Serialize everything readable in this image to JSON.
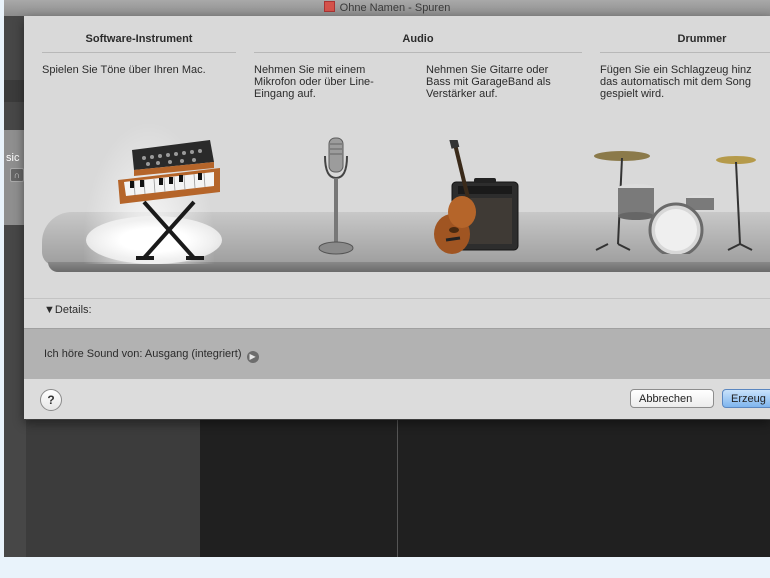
{
  "window": {
    "title": "Ohne Namen - Spuren"
  },
  "background": {
    "left_label": "sic"
  },
  "dialog": {
    "columns": [
      {
        "heading": "Software-Instrument",
        "description": [
          "Spielen Sie Töne über Ihren Mac."
        ]
      },
      {
        "heading": "Audio"
      },
      {
        "heading": "Drummer",
        "description": [
          "Fügen Sie ein Schlagzeug hinz",
          "das automatisch mit dem Song",
          "gespielt wird."
        ]
      }
    ],
    "audio_options": [
      {
        "description": [
          "Nehmen Sie mit einem",
          "Mikrofon oder über Line-",
          "Eingang auf."
        ],
        "icon": "microphone-icon"
      },
      {
        "description": [
          "Nehmen Sie Gitarre oder",
          "Bass mit GarageBand als",
          "Verstärker auf."
        ],
        "icon": "guitar-amp-icon"
      }
    ],
    "instrument_icons": [
      "synthesizer-keyboard-icon",
      "microphone-icon",
      "guitar-amp-icon",
      "drum-kit-icon"
    ],
    "details_label": "▼Details:",
    "sound_source": "Ich höre Sound von: Ausgang (integriert)",
    "buttons": {
      "help": "?",
      "cancel": "Abbrechen",
      "create": "Erzeug"
    }
  },
  "colors": {
    "accent_button": "#7fb5ee",
    "stage": "#b5b5b5",
    "wood": "#b5652a"
  }
}
